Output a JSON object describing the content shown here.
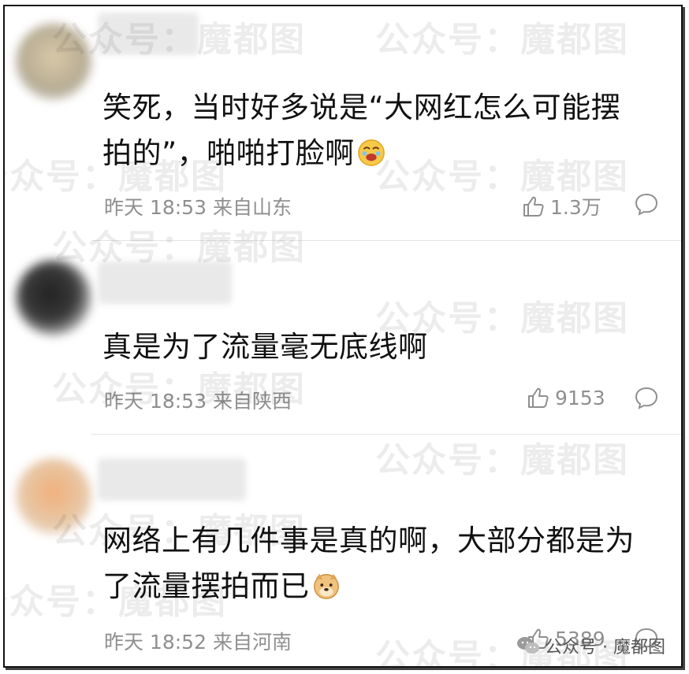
{
  "watermark": "公众号：魔都图",
  "corner_badge": {
    "icon": "wechat-icon",
    "text": "公众号 · 魔都图"
  },
  "comments": [
    {
      "text": "笑死，当时好多说是“大网红怎么可能摆拍的”，啪啪打脸啊",
      "emoji": "laughing-tears-emoji",
      "time": "昨天 18:53",
      "location": "来自山东",
      "likes": "1.3万"
    },
    {
      "text": "真是为了流量毫无底线啊",
      "emoji": "",
      "time": "昨天 18:53",
      "location": "来自陕西",
      "likes": "9153"
    },
    {
      "text": "网络上有几件事是真的啊，大部分都是为了流量摆拍而已",
      "emoji": "doge-emoji",
      "time": "昨天 18:52",
      "location": "来自河南",
      "likes": "5389"
    }
  ]
}
